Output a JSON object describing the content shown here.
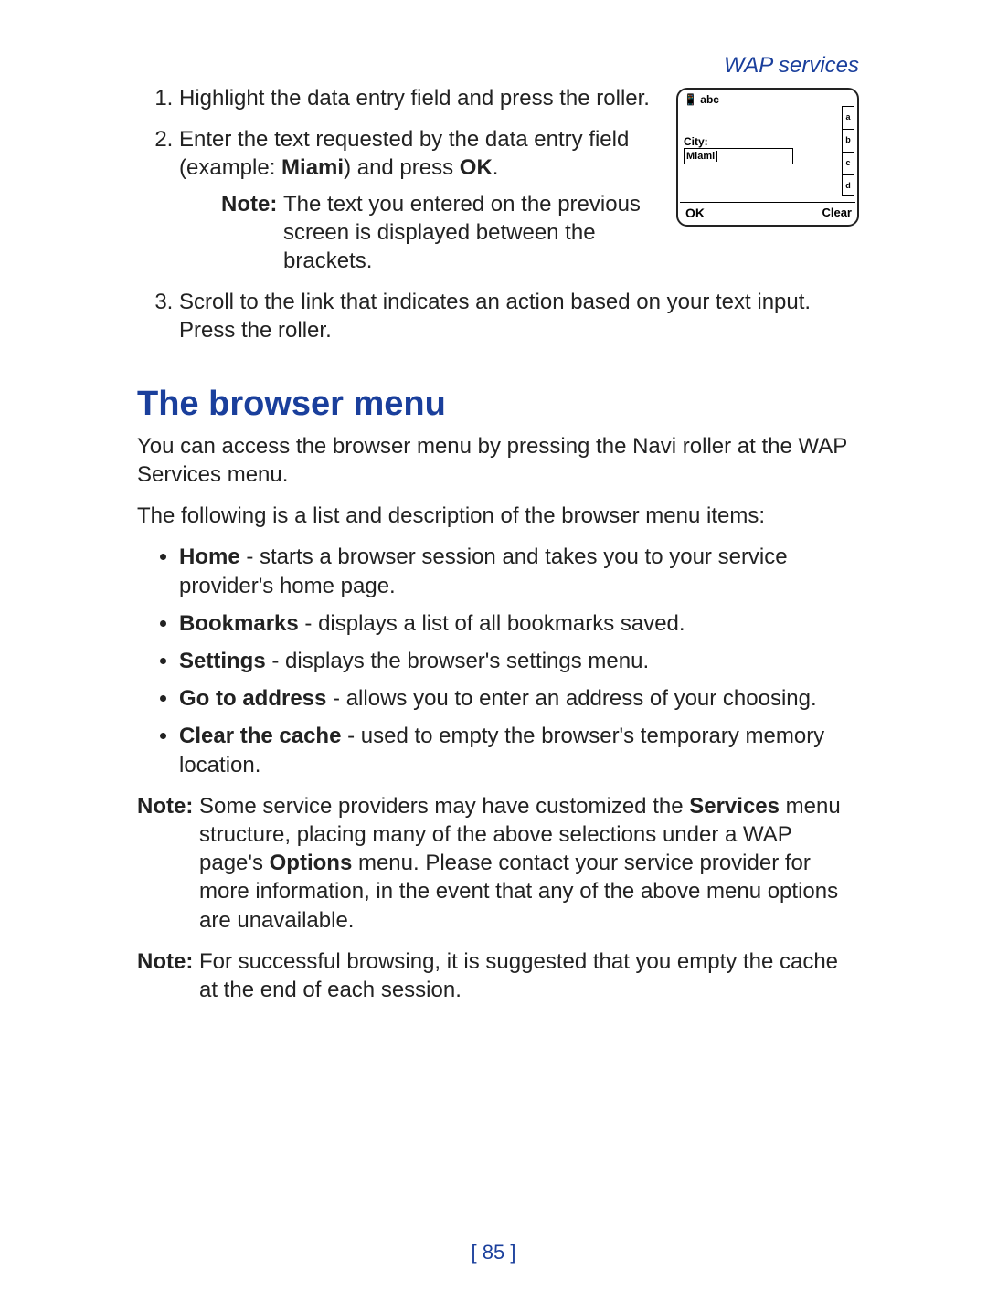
{
  "header": {
    "section": "WAP services"
  },
  "steps": {
    "s1": "Highlight the data entry field and press the roller.",
    "s2_a": "Enter the text requested by the data entry field (example: ",
    "s2_b": "Miami",
    "s2_c": ") and press ",
    "s2_d": "OK",
    "s2_e": ".",
    "note_label": "Note:",
    "note_text": "The text you entered on the previous screen is displayed between the brackets.",
    "s3": "Scroll to the link that indicates an action based on your text input. Press the roller."
  },
  "section": {
    "title": "The browser menu",
    "intro1": "You can access the browser menu by pressing the Navi roller at the WAP Services menu.",
    "intro2": "The following is a list and description of the browser menu items:"
  },
  "bullets": {
    "b1_t": "Home",
    "b1_r": " - starts a browser session and takes you to your service provider's home page.",
    "b2_t": "Bookmarks",
    "b2_r": " - displays a list of all bookmarks saved.",
    "b3_t": "Settings",
    "b3_r": " - displays the browser's settings menu.",
    "b4_t": "Go to address",
    "b4_r": " - allows you to enter an address of your choosing.",
    "b5_t": "Clear the cache",
    "b5_r": " - used to empty the browser's temporary memory location."
  },
  "notes": {
    "label": "Note:",
    "n1_a": "Some service providers may have customized the ",
    "n1_b": "Services",
    "n1_c": " menu structure, placing many of the above selections under a WAP page's ",
    "n1_d": "Options",
    "n1_e": " menu. Please contact your service provider for more information, in the event that any of the above menu options are unavailable.",
    "n2": "For successful browsing, it is suggested that you empty the cache at the end of each session."
  },
  "page_number": "[ 85 ]",
  "phone": {
    "mode": "abc",
    "field_label": "City:",
    "field_value": "Miami",
    "scroll": [
      "a",
      "b",
      "c",
      "d"
    ],
    "left_soft": "OK",
    "right_soft": "Clear"
  }
}
